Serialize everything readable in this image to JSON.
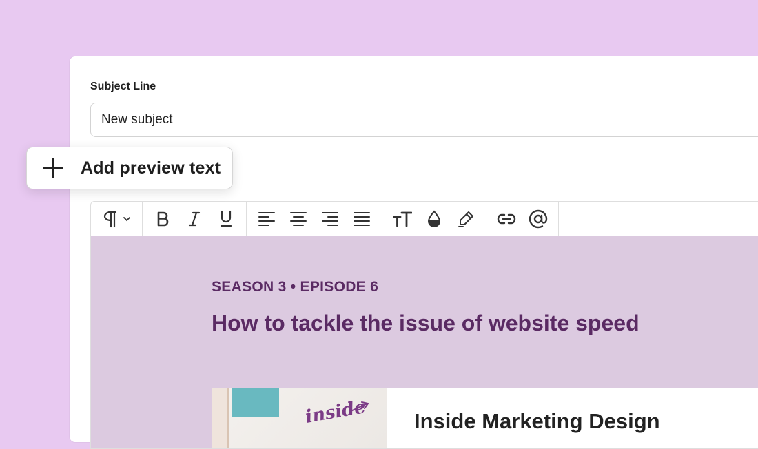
{
  "subject": {
    "label": "Subject Line",
    "value": "New subject"
  },
  "preview": {
    "label": "Add preview text",
    "icon": "plus-icon"
  },
  "toolbar": {
    "groups": [
      [
        "paragraph-icon",
        "chevron-down-icon"
      ],
      [
        "bold-icon",
        "italic-icon",
        "underline-icon"
      ],
      [
        "align-left-icon",
        "align-center-icon",
        "align-right-icon",
        "align-justify-icon"
      ],
      [
        "font-size-icon",
        "text-color-icon",
        "highlight-icon"
      ],
      [
        "link-icon",
        "mention-icon"
      ]
    ]
  },
  "email": {
    "episode": "SEASON 3 • EPISODE 6",
    "headline": "How to tackle the issue of website speed",
    "article_title": "Inside Marketing Design",
    "thumbnail_text": "inside"
  },
  "colors": {
    "background": "#e8c9f1",
    "content_background": "#dccae0",
    "accent_text": "#5a2a63"
  }
}
